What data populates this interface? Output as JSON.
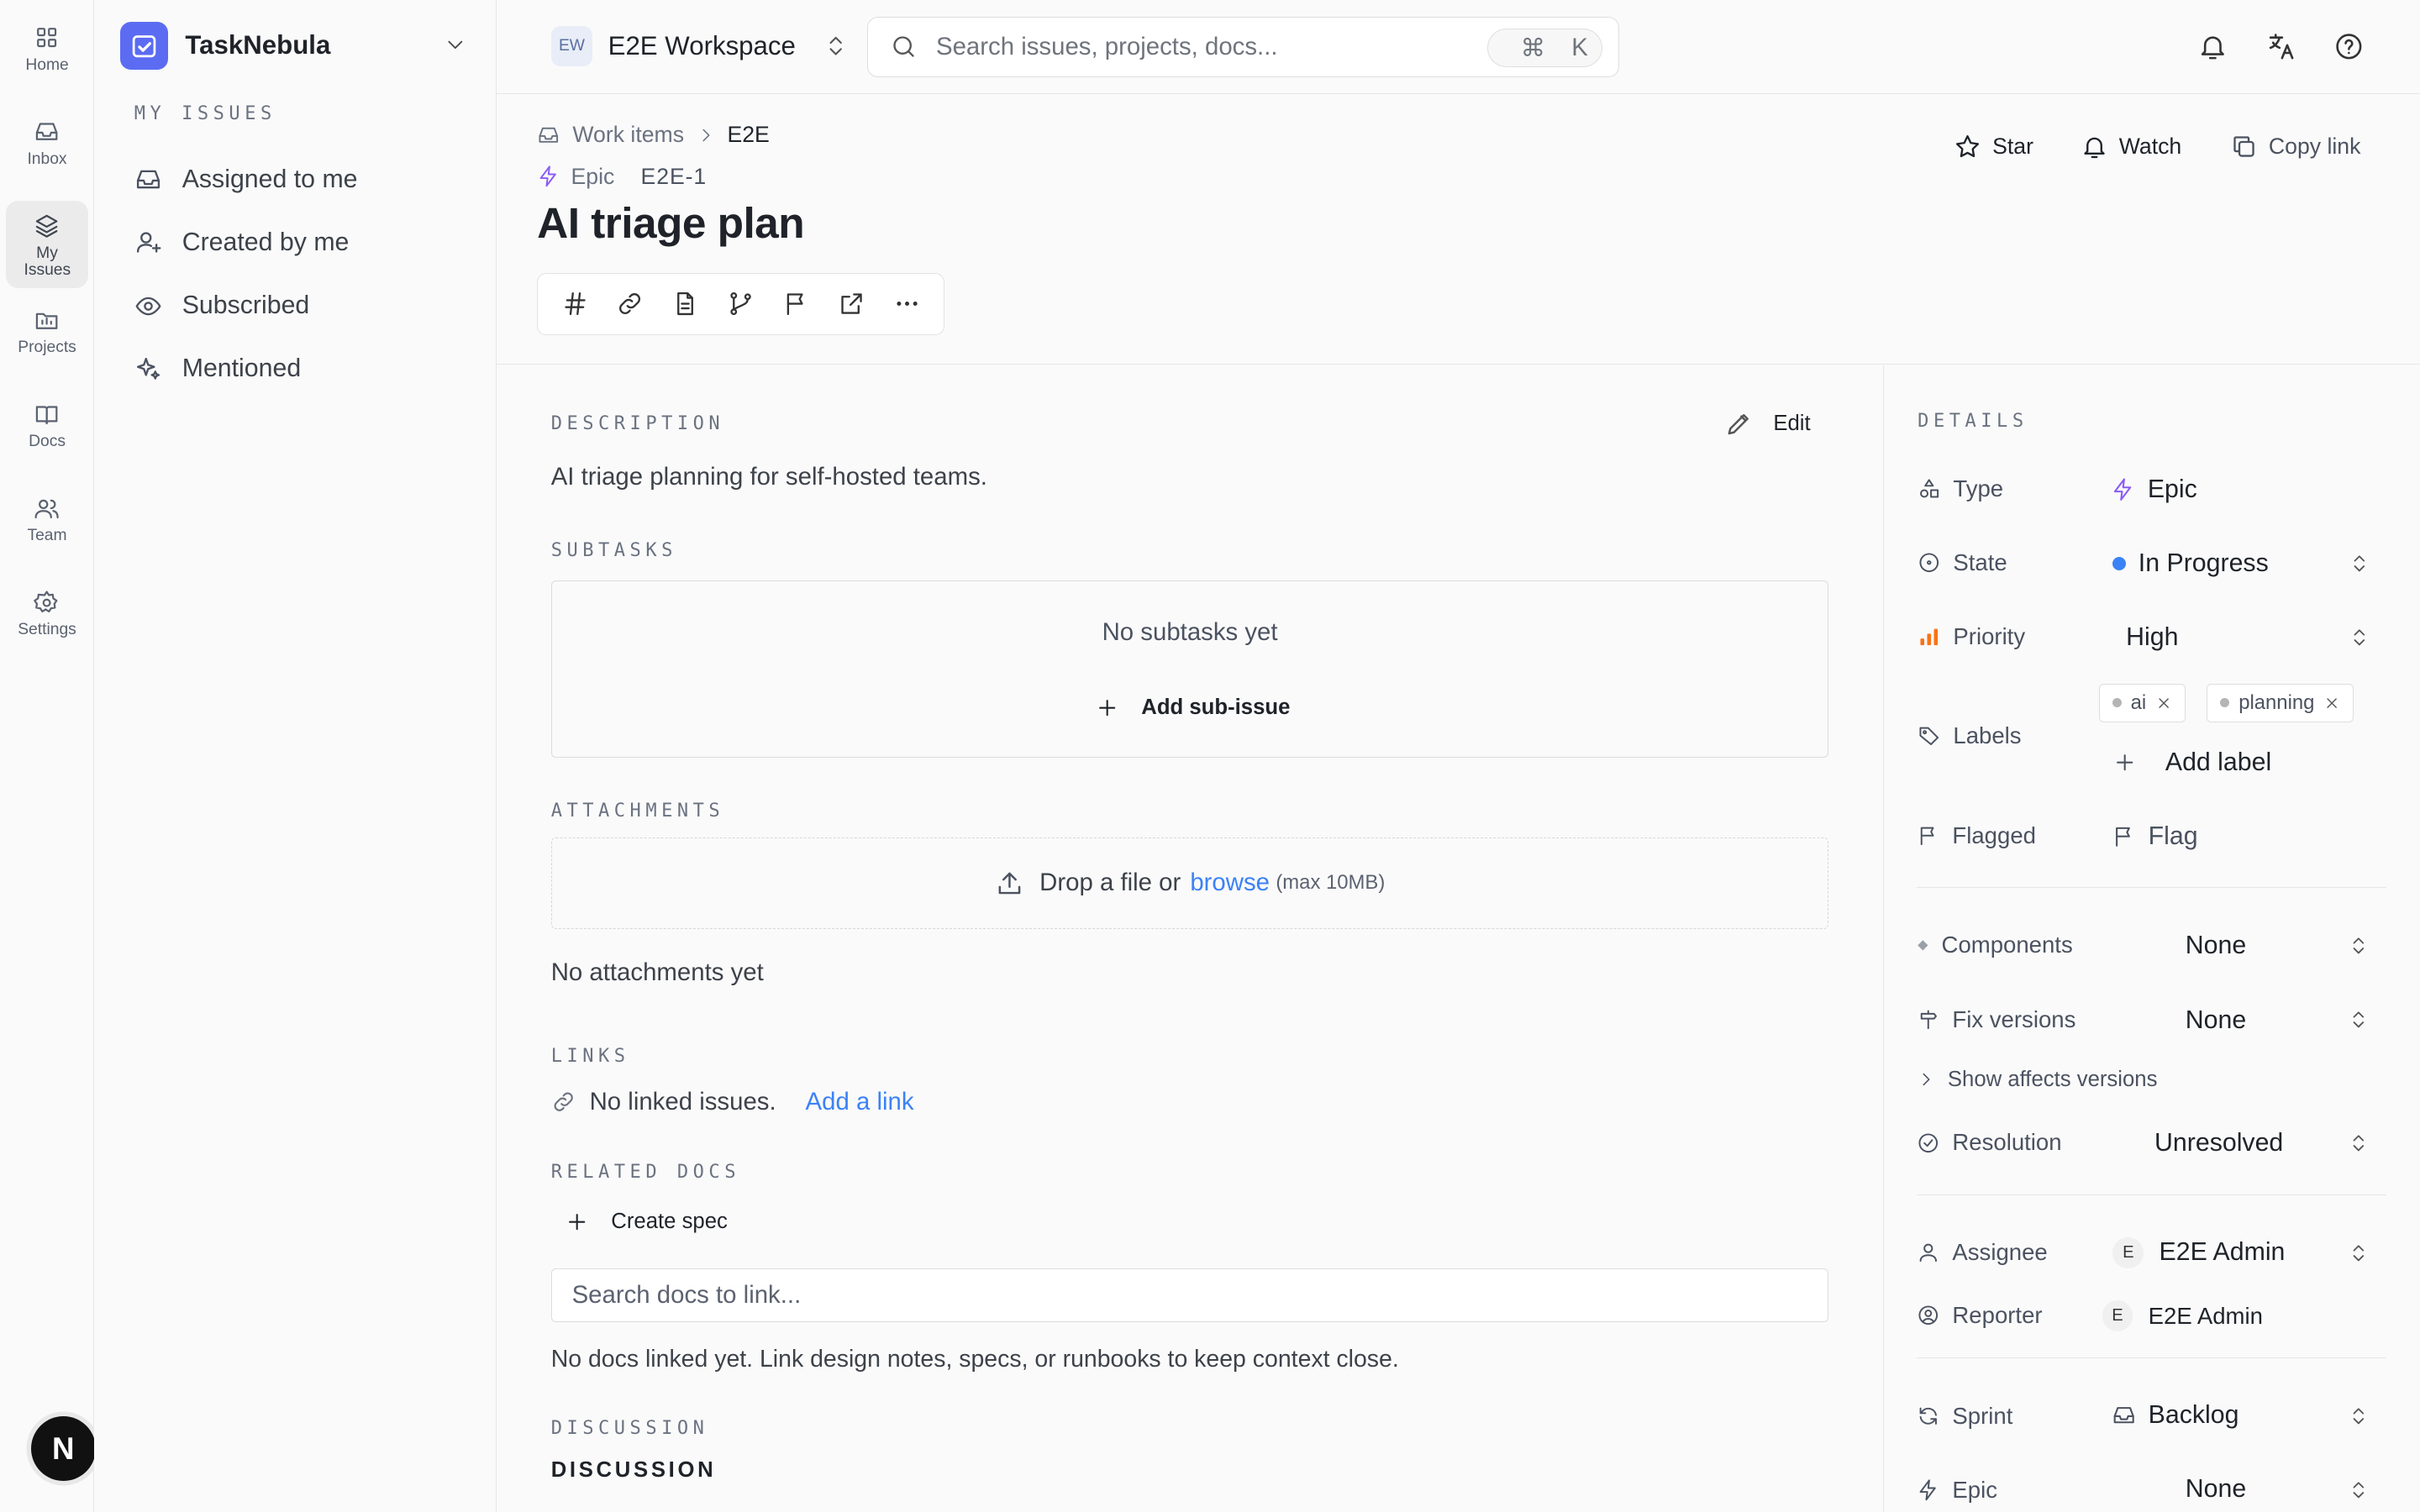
{
  "rail": {
    "home": "Home",
    "inbox": "Inbox",
    "my_issues": "My Issues",
    "projects": "Projects",
    "docs": "Docs",
    "team": "Team",
    "settings": "Settings",
    "avatar": "N"
  },
  "sidebar": {
    "brand": "TaskNebula",
    "section": "MY ISSUES",
    "items": [
      {
        "label": "Assigned to me"
      },
      {
        "label": "Created by me"
      },
      {
        "label": "Subscribed"
      },
      {
        "label": "Mentioned"
      }
    ]
  },
  "topbar": {
    "workspace_badge": "EW",
    "workspace": "E2E Workspace",
    "search_placeholder": "Search issues, projects, docs...",
    "kbd_cmd": "⌘",
    "kbd_key": "K"
  },
  "issue": {
    "breadcrumb": [
      "Work items",
      "E2E"
    ],
    "type": "Epic",
    "key": "E2E-1",
    "title": "AI triage plan",
    "actions": {
      "star": "Star",
      "watch": "Watch",
      "copy": "Copy link"
    }
  },
  "main": {
    "description_label": "DESCRIPTION",
    "edit": "Edit",
    "description": "AI triage planning for self-hosted teams.",
    "subtasks_label": "SUBTASKS",
    "subtasks_empty": "No subtasks yet",
    "add_subissue": "Add sub-issue",
    "attachments_label": "ATTACHMENTS",
    "drop_prefix": "Drop a file or",
    "drop_link": "browse",
    "drop_suffix": "(max 10MB)",
    "attachments_empty": "No attachments yet",
    "links_label": "LINKS",
    "links_empty": "No linked issues.",
    "add_link": "Add a link",
    "related_label": "RELATED DOCS",
    "create_spec": "Create spec",
    "docs_search_placeholder": "Search docs to link...",
    "docs_empty": "No docs linked yet. Link design notes, specs, or runbooks to keep context close.",
    "discussion_label": "DISCUSSION",
    "discussion_title": "DISCUSSION"
  },
  "details": {
    "label": "DETAILS",
    "type_label": "Type",
    "type_value": "Epic",
    "state_label": "State",
    "state_value": "In Progress",
    "priority_label": "Priority",
    "priority_value": "High",
    "labels_label": "Labels",
    "labels": [
      "ai",
      "planning"
    ],
    "add_label": "Add label",
    "flagged_label": "Flagged",
    "flag_value": "Flag",
    "components_label": "Components",
    "components_value": "None",
    "fix_label": "Fix versions",
    "fix_value": "None",
    "affects_toggle": "Show affects versions",
    "resolution_label": "Resolution",
    "resolution_value": "Unresolved",
    "assignee_label": "Assignee",
    "assignee_initial": "E",
    "assignee_value": "E2E Admin",
    "reporter_label": "Reporter",
    "reporter_initial": "E",
    "reporter_value": "E2E Admin",
    "sprint_label": "Sprint",
    "sprint_value": "Backlog",
    "epic_label": "Epic",
    "epic_value": "None"
  },
  "colors": {
    "accent": "#5b6cf2",
    "link": "#3b82f6",
    "epic": "#8b5cf6",
    "state_dot": "#3b82f6",
    "priority": "#f97316"
  }
}
